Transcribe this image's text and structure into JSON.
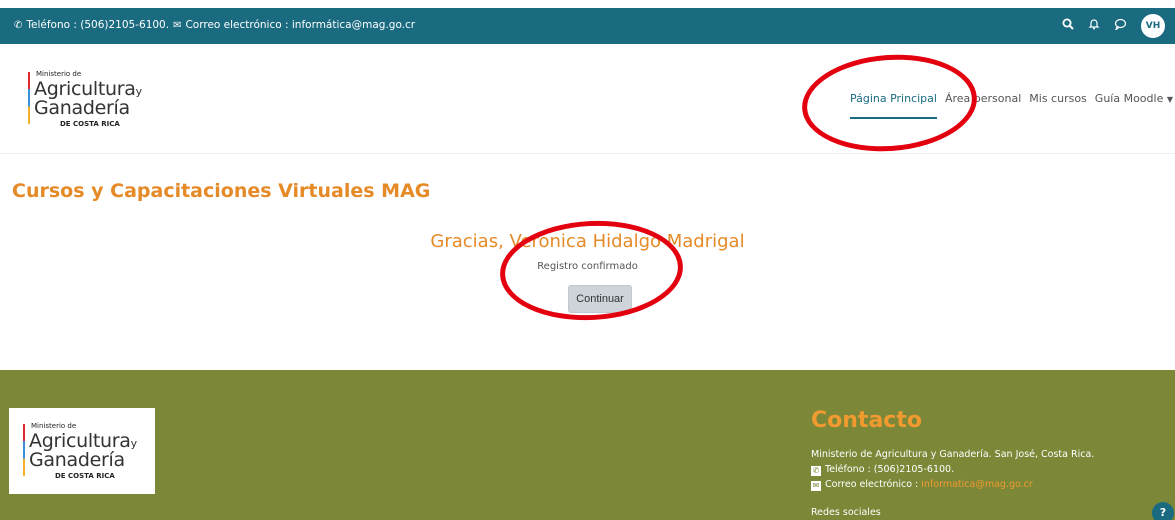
{
  "topbar": {
    "phone": "Teléfono : (506)2105-6100.",
    "email": "Correo electrónico : informática@mag.go.cr",
    "avatar_initials": "VH",
    "icons": [
      "phone-icon",
      "envelope-icon",
      "search-icon",
      "bell-icon",
      "chat-icon"
    ],
    "color": "#1a6a80"
  },
  "logo": {
    "line1": "Ministerio de",
    "line2": "Agricultura",
    "line2_suffix": "y",
    "line3": "Ganadería",
    "line4": "DE COSTA RICA"
  },
  "nav": {
    "items": [
      {
        "label": "Página Principal",
        "active": true
      },
      {
        "label": "Área personal",
        "active": false
      },
      {
        "label": "Mis cursos",
        "active": false
      },
      {
        "label": "Guía Moodle",
        "active": false,
        "dropdown": true
      }
    ]
  },
  "main": {
    "title": "Cursos y Capacitaciones Virtuales MAG",
    "greeting": "Gracias, Veronica Hidalgo Madrigal",
    "subtitle": "Registro confirmado",
    "continue_label": "Continuar",
    "accent": "#e58a26"
  },
  "footer": {
    "contact_title": "Contacto",
    "address": "Ministerio de Agricultura y Ganadería. San José, Costa Rica.",
    "phone": "Teléfono : (506)2105-6100.",
    "email_label": "Correo electrónico :",
    "email": "informatica@mag.go.cr",
    "social_label": "Redes sociales",
    "help_label": "?",
    "background": "#7c8838"
  },
  "annotations": {
    "color": "#e3000f"
  }
}
